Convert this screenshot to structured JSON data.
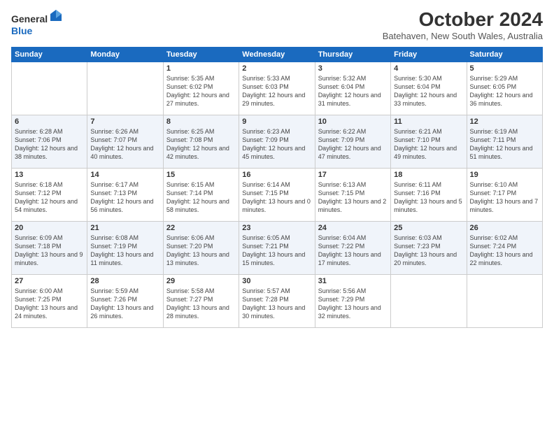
{
  "logo": {
    "general": "General",
    "blue": "Blue"
  },
  "title": "October 2024",
  "location": "Batehaven, New South Wales, Australia",
  "days_of_week": [
    "Sunday",
    "Monday",
    "Tuesday",
    "Wednesday",
    "Thursday",
    "Friday",
    "Saturday"
  ],
  "weeks": [
    [
      {
        "day": "",
        "sunrise": "",
        "sunset": "",
        "daylight": ""
      },
      {
        "day": "",
        "sunrise": "",
        "sunset": "",
        "daylight": ""
      },
      {
        "day": "1",
        "sunrise": "Sunrise: 5:35 AM",
        "sunset": "Sunset: 6:02 PM",
        "daylight": "Daylight: 12 hours and 27 minutes."
      },
      {
        "day": "2",
        "sunrise": "Sunrise: 5:33 AM",
        "sunset": "Sunset: 6:03 PM",
        "daylight": "Daylight: 12 hours and 29 minutes."
      },
      {
        "day": "3",
        "sunrise": "Sunrise: 5:32 AM",
        "sunset": "Sunset: 6:04 PM",
        "daylight": "Daylight: 12 hours and 31 minutes."
      },
      {
        "day": "4",
        "sunrise": "Sunrise: 5:30 AM",
        "sunset": "Sunset: 6:04 PM",
        "daylight": "Daylight: 12 hours and 33 minutes."
      },
      {
        "day": "5",
        "sunrise": "Sunrise: 5:29 AM",
        "sunset": "Sunset: 6:05 PM",
        "daylight": "Daylight: 12 hours and 36 minutes."
      }
    ],
    [
      {
        "day": "6",
        "sunrise": "Sunrise: 6:28 AM",
        "sunset": "Sunset: 7:06 PM",
        "daylight": "Daylight: 12 hours and 38 minutes."
      },
      {
        "day": "7",
        "sunrise": "Sunrise: 6:26 AM",
        "sunset": "Sunset: 7:07 PM",
        "daylight": "Daylight: 12 hours and 40 minutes."
      },
      {
        "day": "8",
        "sunrise": "Sunrise: 6:25 AM",
        "sunset": "Sunset: 7:08 PM",
        "daylight": "Daylight: 12 hours and 42 minutes."
      },
      {
        "day": "9",
        "sunrise": "Sunrise: 6:23 AM",
        "sunset": "Sunset: 7:09 PM",
        "daylight": "Daylight: 12 hours and 45 minutes."
      },
      {
        "day": "10",
        "sunrise": "Sunrise: 6:22 AM",
        "sunset": "Sunset: 7:09 PM",
        "daylight": "Daylight: 12 hours and 47 minutes."
      },
      {
        "day": "11",
        "sunrise": "Sunrise: 6:21 AM",
        "sunset": "Sunset: 7:10 PM",
        "daylight": "Daylight: 12 hours and 49 minutes."
      },
      {
        "day": "12",
        "sunrise": "Sunrise: 6:19 AM",
        "sunset": "Sunset: 7:11 PM",
        "daylight": "Daylight: 12 hours and 51 minutes."
      }
    ],
    [
      {
        "day": "13",
        "sunrise": "Sunrise: 6:18 AM",
        "sunset": "Sunset: 7:12 PM",
        "daylight": "Daylight: 12 hours and 54 minutes."
      },
      {
        "day": "14",
        "sunrise": "Sunrise: 6:17 AM",
        "sunset": "Sunset: 7:13 PM",
        "daylight": "Daylight: 12 hours and 56 minutes."
      },
      {
        "day": "15",
        "sunrise": "Sunrise: 6:15 AM",
        "sunset": "Sunset: 7:14 PM",
        "daylight": "Daylight: 12 hours and 58 minutes."
      },
      {
        "day": "16",
        "sunrise": "Sunrise: 6:14 AM",
        "sunset": "Sunset: 7:15 PM",
        "daylight": "Daylight: 13 hours and 0 minutes."
      },
      {
        "day": "17",
        "sunrise": "Sunrise: 6:13 AM",
        "sunset": "Sunset: 7:15 PM",
        "daylight": "Daylight: 13 hours and 2 minutes."
      },
      {
        "day": "18",
        "sunrise": "Sunrise: 6:11 AM",
        "sunset": "Sunset: 7:16 PM",
        "daylight": "Daylight: 13 hours and 5 minutes."
      },
      {
        "day": "19",
        "sunrise": "Sunrise: 6:10 AM",
        "sunset": "Sunset: 7:17 PM",
        "daylight": "Daylight: 13 hours and 7 minutes."
      }
    ],
    [
      {
        "day": "20",
        "sunrise": "Sunrise: 6:09 AM",
        "sunset": "Sunset: 7:18 PM",
        "daylight": "Daylight: 13 hours and 9 minutes."
      },
      {
        "day": "21",
        "sunrise": "Sunrise: 6:08 AM",
        "sunset": "Sunset: 7:19 PM",
        "daylight": "Daylight: 13 hours and 11 minutes."
      },
      {
        "day": "22",
        "sunrise": "Sunrise: 6:06 AM",
        "sunset": "Sunset: 7:20 PM",
        "daylight": "Daylight: 13 hours and 13 minutes."
      },
      {
        "day": "23",
        "sunrise": "Sunrise: 6:05 AM",
        "sunset": "Sunset: 7:21 PM",
        "daylight": "Daylight: 13 hours and 15 minutes."
      },
      {
        "day": "24",
        "sunrise": "Sunrise: 6:04 AM",
        "sunset": "Sunset: 7:22 PM",
        "daylight": "Daylight: 13 hours and 17 minutes."
      },
      {
        "day": "25",
        "sunrise": "Sunrise: 6:03 AM",
        "sunset": "Sunset: 7:23 PM",
        "daylight": "Daylight: 13 hours and 20 minutes."
      },
      {
        "day": "26",
        "sunrise": "Sunrise: 6:02 AM",
        "sunset": "Sunset: 7:24 PM",
        "daylight": "Daylight: 13 hours and 22 minutes."
      }
    ],
    [
      {
        "day": "27",
        "sunrise": "Sunrise: 6:00 AM",
        "sunset": "Sunset: 7:25 PM",
        "daylight": "Daylight: 13 hours and 24 minutes."
      },
      {
        "day": "28",
        "sunrise": "Sunrise: 5:59 AM",
        "sunset": "Sunset: 7:26 PM",
        "daylight": "Daylight: 13 hours and 26 minutes."
      },
      {
        "day": "29",
        "sunrise": "Sunrise: 5:58 AM",
        "sunset": "Sunset: 7:27 PM",
        "daylight": "Daylight: 13 hours and 28 minutes."
      },
      {
        "day": "30",
        "sunrise": "Sunrise: 5:57 AM",
        "sunset": "Sunset: 7:28 PM",
        "daylight": "Daylight: 13 hours and 30 minutes."
      },
      {
        "day": "31",
        "sunrise": "Sunrise: 5:56 AM",
        "sunset": "Sunset: 7:29 PM",
        "daylight": "Daylight: 13 hours and 32 minutes."
      },
      {
        "day": "",
        "sunrise": "",
        "sunset": "",
        "daylight": ""
      },
      {
        "day": "",
        "sunrise": "",
        "sunset": "",
        "daylight": ""
      }
    ]
  ]
}
